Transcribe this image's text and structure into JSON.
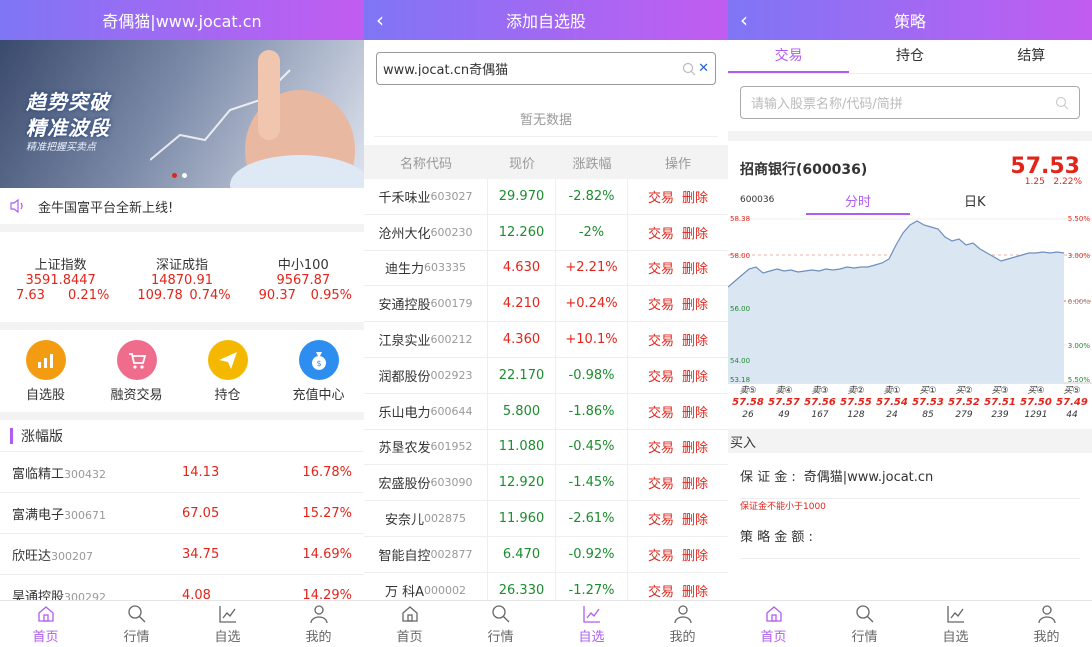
{
  "panel1": {
    "title": "奇偶猫|www.jocat.cn",
    "banner": {
      "line1": "趋势突破",
      "line2": "精准波段",
      "line3": "精准把握买卖点"
    },
    "notice": "金牛国富平台全新上线!",
    "indices": [
      {
        "name": "上证指数",
        "value": "3591.8447",
        "change": "7.63",
        "pct": "0.21%"
      },
      {
        "name": "深证成指",
        "value": "14870.91",
        "change": "109.78",
        "pct": "0.74%"
      },
      {
        "name": "中小100",
        "value": "9567.87",
        "change": "90.37",
        "pct": "0.95%"
      }
    ],
    "icons": [
      {
        "label": "自选股",
        "icon": "chart-icon",
        "color": "#f39c12"
      },
      {
        "label": "融资交易",
        "icon": "cart-icon",
        "color": "#f06c8c"
      },
      {
        "label": "持仓",
        "icon": "plane-icon",
        "color": "#f5b800"
      },
      {
        "label": "充值中心",
        "icon": "money-bag-icon",
        "color": "#2e8ef0"
      }
    ],
    "section_title": "涨幅版",
    "rows": [
      {
        "name": "富临精工",
        "code": "300432",
        "price": "14.13",
        "pct": "16.78%"
      },
      {
        "name": "富满电子",
        "code": "300671",
        "price": "67.05",
        "pct": "15.27%"
      },
      {
        "name": "欣旺达",
        "code": "300207",
        "price": "34.75",
        "pct": "14.69%"
      },
      {
        "name": "昊通控股",
        "code": "300292",
        "price": "4.08",
        "pct": "14.29%"
      }
    ]
  },
  "panel2": {
    "title": "添加自选股",
    "search_value": "www.jocat.cn奇偶猫",
    "no_data": "暂无数据",
    "headers": [
      "名称代码",
      "现价",
      "涨跌幅",
      "操作"
    ],
    "action_trade": "交易",
    "action_delete": "删除",
    "rows": [
      {
        "name": "千禾味业",
        "code": "603027",
        "price": "29.970",
        "pct": "-2.82%",
        "dir": "down"
      },
      {
        "name": "沧州大化",
        "code": "600230",
        "price": "12.260",
        "pct": "-2%",
        "dir": "down"
      },
      {
        "name": "迪生力",
        "code": "603335",
        "price": "4.630",
        "pct": "+2.21%",
        "dir": "up"
      },
      {
        "name": "安通控股",
        "code": "600179",
        "price": "4.210",
        "pct": "+0.24%",
        "dir": "up"
      },
      {
        "name": "江泉实业",
        "code": "600212",
        "price": "4.360",
        "pct": "+10.1%",
        "dir": "up"
      },
      {
        "name": "润都股份",
        "code": "002923",
        "price": "22.170",
        "pct": "-0.98%",
        "dir": "down"
      },
      {
        "name": "乐山电力",
        "code": "600644",
        "price": "5.800",
        "pct": "-1.86%",
        "dir": "down"
      },
      {
        "name": "苏垦农发",
        "code": "601952",
        "price": "11.080",
        "pct": "-0.45%",
        "dir": "down"
      },
      {
        "name": "宏盛股份",
        "code": "603090",
        "price": "12.920",
        "pct": "-1.45%",
        "dir": "down"
      },
      {
        "name": "安奈儿",
        "code": "002875",
        "price": "11.960",
        "pct": "-2.61%",
        "dir": "down"
      },
      {
        "name": "智能自控",
        "code": "002877",
        "price": "6.470",
        "pct": "-0.92%",
        "dir": "down"
      },
      {
        "name": "万 科A",
        "code": "000002",
        "price": "26.330",
        "pct": "-1.27%",
        "dir": "down"
      }
    ]
  },
  "panel3": {
    "title": "策略",
    "tabs": [
      "交易",
      "持仓",
      "结算"
    ],
    "search_placeholder": "请输入股票名称/代码/简拼",
    "stock_name": "招商银行(600036)",
    "price": "57.53",
    "code_small": "600036",
    "chart_tab1": "分时",
    "chart_tab2": "日K",
    "change": "1.25",
    "change_pct": "2.22%",
    "y_labels_left": [
      "58.38",
      "58.00",
      "56.00",
      "54.00",
      "53.18"
    ],
    "y_labels_right": [
      "5.50%",
      "3.00%",
      "0.00%",
      "3.00%",
      "5.50%"
    ],
    "book": [
      {
        "label": "卖⑤",
        "price": "57.58",
        "vol": "26"
      },
      {
        "label": "卖④",
        "price": "57.57",
        "vol": "49"
      },
      {
        "label": "卖③",
        "price": "57.56",
        "vol": "167"
      },
      {
        "label": "卖②",
        "price": "57.55",
        "vol": "128"
      },
      {
        "label": "卖①",
        "price": "57.54",
        "vol": "24"
      },
      {
        "label": "买①",
        "price": "57.53",
        "vol": "85"
      },
      {
        "label": "买②",
        "price": "57.52",
        "vol": "279"
      },
      {
        "label": "买③",
        "price": "57.51",
        "vol": "239"
      },
      {
        "label": "买④",
        "price": "57.50",
        "vol": "1291"
      },
      {
        "label": "买⑤",
        "price": "57.49",
        "vol": "44"
      }
    ],
    "buy_label": "买入",
    "deposit_label": "保 证 金 :",
    "deposit_value": "奇偶猫|www.jocat.cn",
    "deposit_note": "保证金不能小于1000",
    "amount_label": "策 略 金 额 :"
  },
  "tabbar": [
    "首页",
    "行情",
    "自选",
    "我的"
  ],
  "colors": {
    "accent": "#b15cf0",
    "up": "#e1251b",
    "down": "#1c8c2e"
  }
}
